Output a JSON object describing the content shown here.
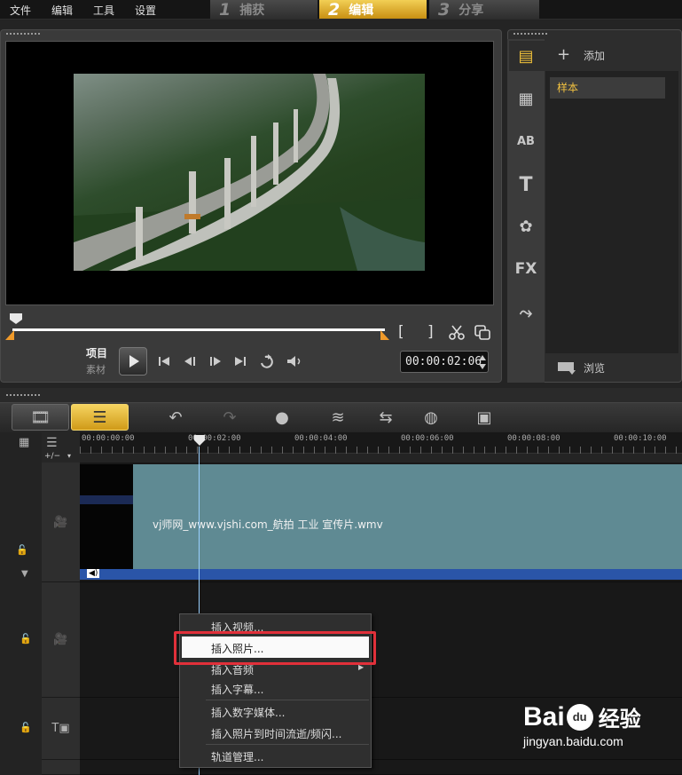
{
  "menubar": {
    "items": [
      "文件",
      "编辑",
      "工具",
      "设置"
    ]
  },
  "steps": [
    {
      "num": "1",
      "label": "捕获"
    },
    {
      "num": "2",
      "label": "编辑"
    },
    {
      "num": "3",
      "label": "分享"
    }
  ],
  "preview": {
    "mode_project": "项目",
    "mode_clip": "素材",
    "timecode": "00:00:02:06",
    "scrub_position": 0.02
  },
  "library": {
    "add_label": "添加",
    "sample_item": "样本",
    "browse_label": "浏览"
  },
  "timeline": {
    "ruler_ticks": [
      "00:00:00:00",
      "00:00:02:00",
      "00:00:04:00",
      "00:00:06:00",
      "00:00:08:00",
      "00:00:10:00"
    ],
    "add_remove_label": "+/−",
    "clip_name": "vj师网_www.vjshi.com_航拍 工业 宣传片.wmv"
  },
  "context_menu": {
    "items": [
      "插入视频...",
      "插入照片...",
      "插入音频",
      "插入字幕...",
      "插入数字媒体...",
      "插入照片到时间流逝/频闪...",
      "轨道管理..."
    ],
    "highlighted": "插入照片..."
  },
  "watermark": {
    "brand": "Bai",
    "paw": "du",
    "cn": "经验",
    "url": "jingyan.baidu.com"
  },
  "colors": {
    "accent": "#f2c23a",
    "highlight_box": "#e1303a",
    "clip": "#5f8a93",
    "audio_strip": "#2a55a8"
  }
}
